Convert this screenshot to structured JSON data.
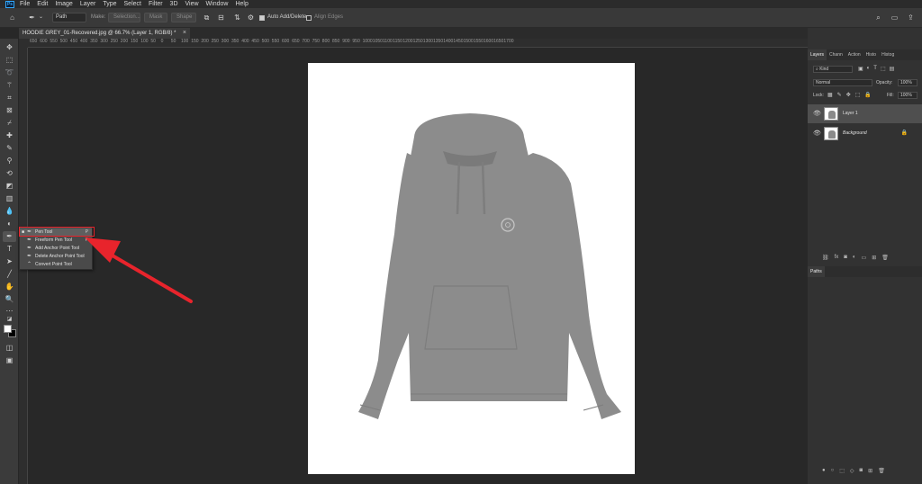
{
  "menu": [
    "File",
    "Edit",
    "Image",
    "Layer",
    "Type",
    "Select",
    "Filter",
    "3D",
    "View",
    "Window",
    "Help"
  ],
  "app_badge": "Ps",
  "options_bar": {
    "mode": "Path",
    "make_label": "Make:",
    "selection_btn": "Selection...",
    "mask_btn": "Mask",
    "shape_btn": "Shape",
    "auto_add_delete_label": "Auto Add/Delete",
    "align_edges_label": "Align Edges"
  },
  "document_tab": {
    "title": "HOODIE GREY_01-Recovered.jpg @ 66.7% (Layer 1, RGB/8) *",
    "close": "×"
  },
  "ruler_ticks": [
    "650",
    "600",
    "550",
    "500",
    "450",
    "400",
    "350",
    "300",
    "250",
    "200",
    "150",
    "100",
    "50",
    "0",
    "50",
    "100",
    "150",
    "200",
    "250",
    "300",
    "350",
    "400",
    "450",
    "500",
    "550",
    "600",
    "650",
    "700",
    "750",
    "800",
    "850",
    "900",
    "950",
    "1000",
    "1050",
    "1100",
    "1150",
    "1200",
    "1250",
    "1300",
    "1350",
    "1400",
    "1450",
    "1500",
    "1550",
    "1600",
    "1650",
    "1700"
  ],
  "tool_flyout": {
    "items": [
      {
        "label": "Pen Tool",
        "key": "P",
        "selected": true
      },
      {
        "label": "Freeform Pen Tool",
        "key": "P",
        "selected": false
      },
      {
        "label": "Add Anchor Point Tool",
        "key": "",
        "selected": false
      },
      {
        "label": "Delete Anchor Point Tool",
        "key": "",
        "selected": false
      },
      {
        "label": "Convert Point Tool",
        "key": "",
        "selected": false
      }
    ]
  },
  "colors": {
    "foreground": "#ffffff",
    "background": "#000000",
    "annotation": "#e8242c",
    "hoodie": "#8c8c8c"
  },
  "layers_panel": {
    "tabs": [
      "Layers",
      "Chann",
      "Action",
      "Histo",
      "Histog"
    ],
    "filter_kind": "Kind",
    "blend_mode": "Normal",
    "opacity_label": "Opacity:",
    "opacity_value": "100%",
    "lock_label": "Lock:",
    "fill_label": "Fill:",
    "fill_value": "100%",
    "layers": [
      {
        "name": "Layer 1",
        "selected": true,
        "locked": false
      },
      {
        "name": "Background",
        "selected": false,
        "locked": true
      }
    ]
  },
  "paths_panel": {
    "tabs": [
      "Paths"
    ]
  }
}
